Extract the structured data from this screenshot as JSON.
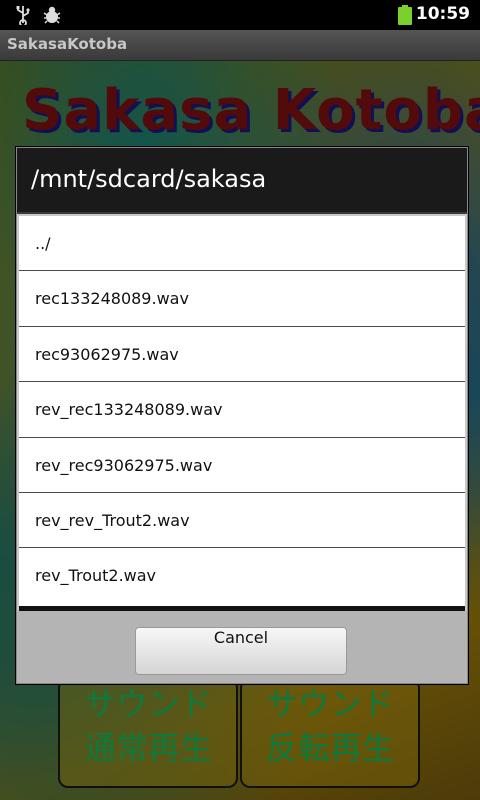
{
  "status_bar": {
    "time": "10:59",
    "icons": [
      "usb-icon",
      "debug-bug-icon",
      "battery-icon"
    ],
    "battery_color": "#7bd12b"
  },
  "app": {
    "title": "SakasaKotoba",
    "logo_text": "Sakasa Kotoba",
    "buttons": [
      {
        "line1": "サウンド",
        "line2": "通常再生"
      },
      {
        "line1": "サウンド",
        "line2": "反転再生"
      }
    ]
  },
  "dialog": {
    "title": "/mnt/sdcard/sakasa",
    "items": [
      "../",
      "rec133248089.wav",
      "rec93062975.wav",
      "rev_rec133248089.wav",
      "rev_rec93062975.wav",
      "rev_rev_Trout2.wav",
      "rev_Trout2.wav"
    ],
    "cancel_label": "Cancel"
  }
}
